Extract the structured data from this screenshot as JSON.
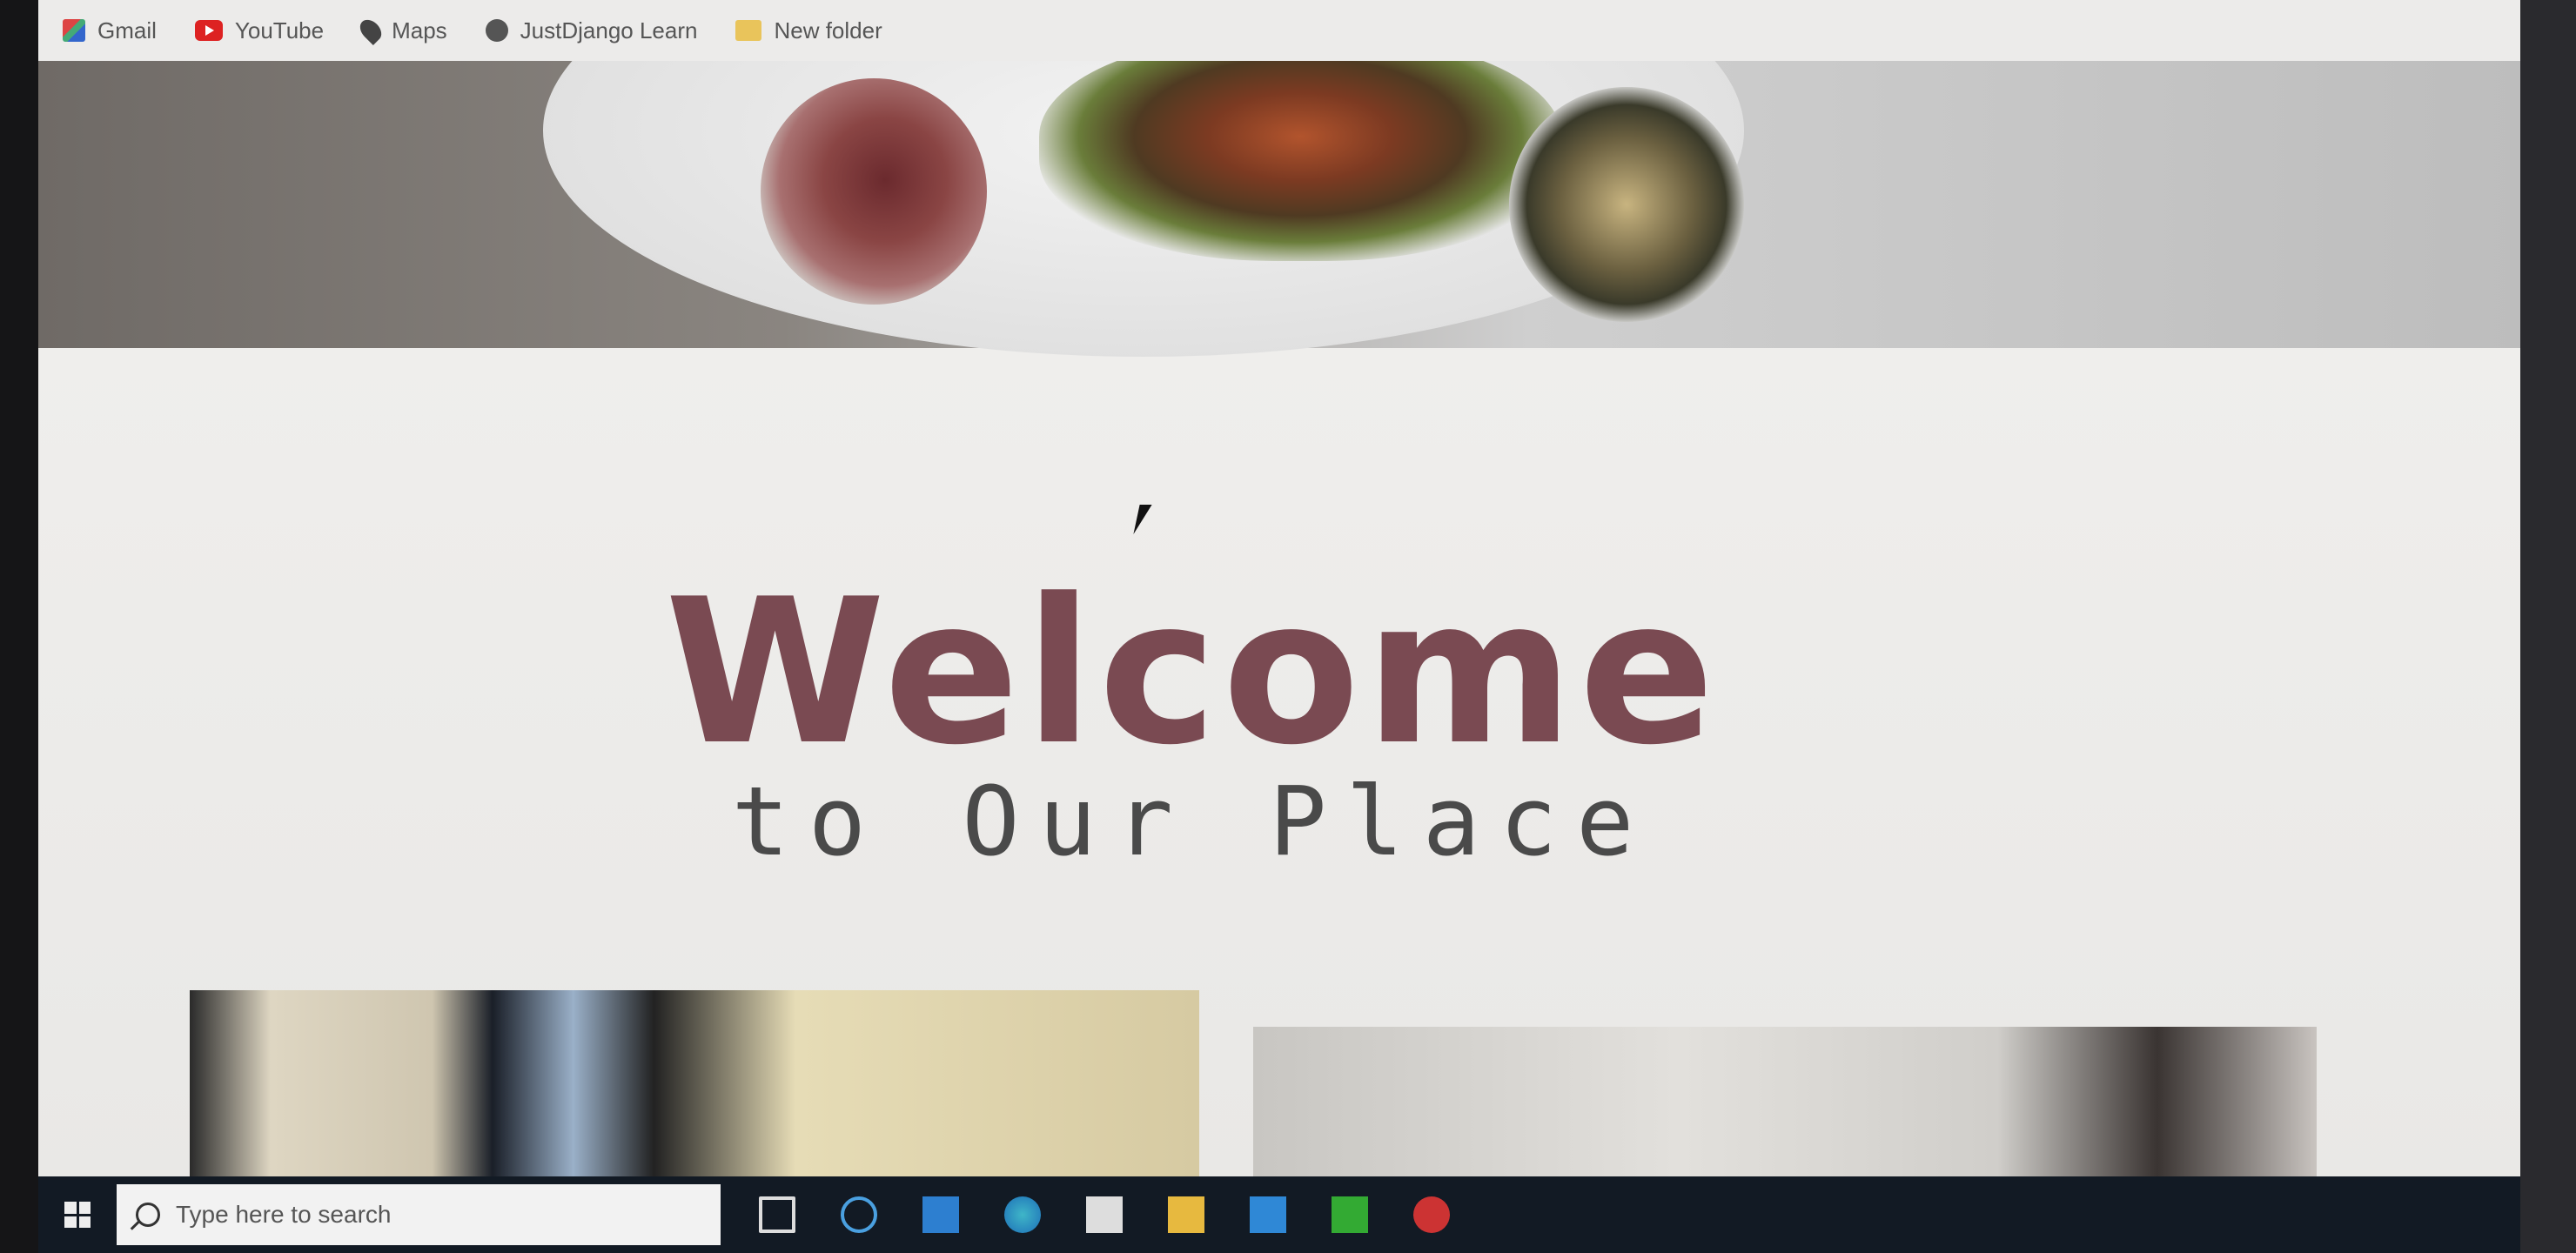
{
  "bookmarks": [
    {
      "label": "Gmail",
      "icon": "gmail-icon"
    },
    {
      "label": "YouTube",
      "icon": "youtube-icon"
    },
    {
      "label": "Maps",
      "icon": "maps-icon"
    },
    {
      "label": "JustDjango Learn",
      "icon": "justdjango-icon"
    },
    {
      "label": "New folder",
      "icon": "folder-icon"
    }
  ],
  "hero": {
    "title": "Welcome",
    "subtitle": "to Our Place",
    "title_color": "#7a4a52"
  },
  "taskbar": {
    "search_placeholder": "Type here to search",
    "apps": [
      "task-view-icon",
      "cortana-icon",
      "mail-icon",
      "edge-icon",
      "store-icon",
      "file-explorer-icon",
      "vscode-icon",
      "terminal-icon",
      "app-icon"
    ]
  }
}
